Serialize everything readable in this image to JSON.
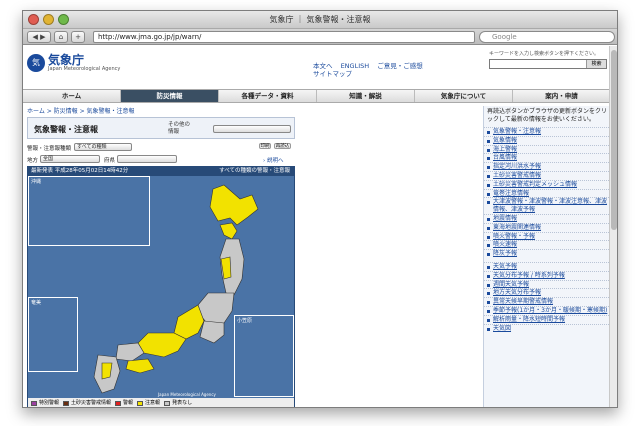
{
  "browser": {
    "window_title": "気象庁 ｜ 気象警報・注意報",
    "url": "http://www.jma.go.jp/jp/warn/",
    "search_placeholder": "Google"
  },
  "header": {
    "logo_text": "気象庁",
    "logo_sub": "Japan Meteorological Agency",
    "links": [
      "本文へ",
      "ENGLISH",
      "ご意見・ご感想",
      "サイトマップ"
    ],
    "search_caption": "キーワードを入力し検索ボタンを押下ください。",
    "search_button": "検索"
  },
  "global_nav": [
    "ホーム",
    "防災情報",
    "各種データ・資料",
    "知識・解説",
    "気象庁について",
    "案内・申請"
  ],
  "breadcrumb": "ホーム > 防災情報 > 気象警報・注意報",
  "panel": {
    "title": "気象警報・注意報",
    "other_label": "その他の情報",
    "warning_type_label": "警報・注意報種類",
    "warning_type_value": "すべての種類",
    "print_label": "印刷",
    "refresh_label": "再読込",
    "region_label": "地方",
    "region_value": "全国",
    "pref_label": "府県",
    "explain_link": "説明へ"
  },
  "map": {
    "issued_label": "最新発表",
    "issued_time": "平成28年05月02日14時42分",
    "filter_text": "すべての種類の警報・注意報",
    "inset_okinawa": "沖縄",
    "inset_amami": "奄美",
    "inset_ogasawara": "小笠原",
    "copyright": "Japan Meteorological Agency",
    "legend": [
      "特別警報",
      "土砂災害警戒情報",
      "警報",
      "注意報",
      "発表なし"
    ],
    "colors": {
      "special": "#9b3fa0",
      "sediment": "#6a2d0f",
      "warning": "#e02020",
      "advisory": "#f2e200",
      "none": "#c8c8c8"
    }
  },
  "sidebar": {
    "note": "再読込ボタンかブラウザの更新ボタンをクリックして最新の情報をお使いください。",
    "items": [
      "気象警報・注意報",
      "気象情報",
      "海上警報",
      "台風情報",
      "指定河川洪水予報",
      "土砂災害警戒情報",
      "土砂災害警戒判定メッシュ情報",
      "竜巻注意情報",
      "大津波警報・津波警報・津波注意報、津波情報、津波予報",
      "地震情報",
      "東海地震関連情報",
      "噴火警報・予報",
      "噴火速報",
      "降灰予報",
      "天気予報",
      "天気分布予報 / 時系列予報",
      "週間天気予報",
      "地方天気分布予報",
      "異常天候早期警戒情報",
      "季節予報(1か月・3か月・暖候期・寒候期)",
      "解析雨量・降水短時間予報",
      "天気図"
    ]
  }
}
